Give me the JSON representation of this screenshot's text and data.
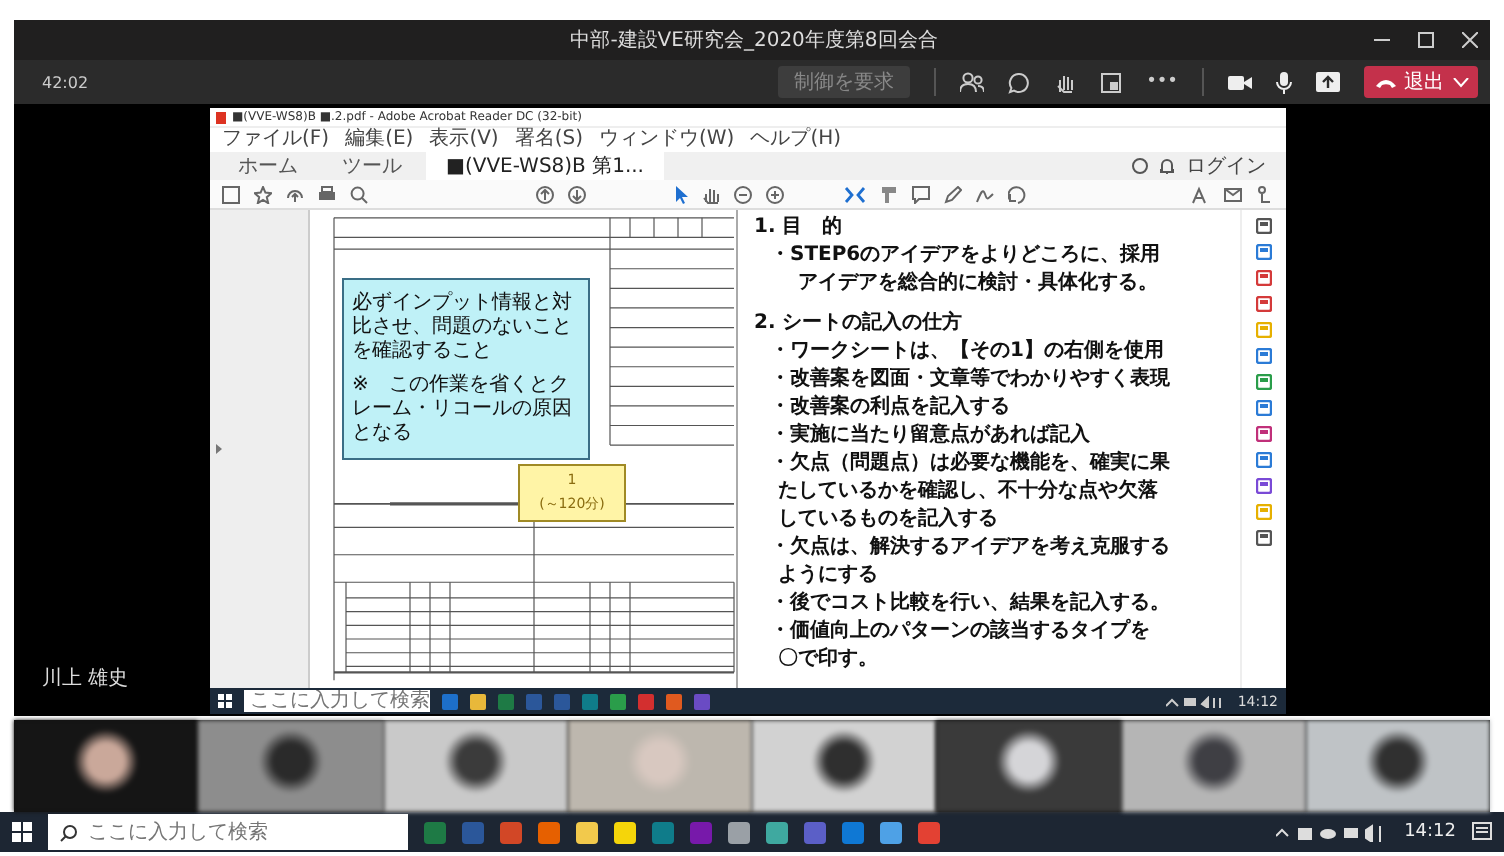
{
  "window": {
    "title": "中部-建設VE研究会_2020年度第8回会合"
  },
  "meeting_bar": {
    "timer": "42:02",
    "request_control": {
      "label": "制御を要求",
      "disabled": true
    },
    "more": "•••",
    "leave": {
      "label": "退出"
    }
  },
  "presenter": {
    "name": "川上 雄史"
  },
  "shared_screen": {
    "app_title": "■(VVE-WS8)B ■.2.pdf - Adobe Acrobat Reader DC (32-bit)",
    "menu": [
      "ファイル(F)",
      "編集(E)",
      "表示(V)",
      "署名(S)",
      "ウィンドウ(W)",
      "ヘルプ(H)"
    ],
    "tabs": [
      {
        "label": "ホーム",
        "selected": false
      },
      {
        "label": "ツール",
        "selected": false
      },
      {
        "label": "■(VVE-WS8)B 第1...",
        "selected": true
      }
    ],
    "sign_in": "ログイン",
    "worksheet": {
      "note": "必ずインプット情報と対比させ、問題のないことを確認すること",
      "warning": "※　この作業を省くとクレーム・リコールの原因となる",
      "step": "1",
      "duration": "(～120分)"
    },
    "document_lines": [
      {
        "kind": "heading",
        "text": "1. 目　的"
      },
      {
        "kind": "bullet",
        "text": "・STEP6のアイデアをよりどころに、採用"
      },
      {
        "kind": "continuation",
        "text": "アイデアを総合的に検討・具体化する。"
      },
      {
        "kind": "section",
        "text": "2. シートの記入の仕方"
      },
      {
        "kind": "bullet",
        "text": "・ワークシートは、【その1】の右側を使用"
      },
      {
        "kind": "bullet",
        "text": "・改善案を図面・文章等でわかりやすく表現"
      },
      {
        "kind": "bullet",
        "text": "・改善案の利点を記入する"
      },
      {
        "kind": "bullet",
        "text": "・実施に当たり留意点があれば記入"
      },
      {
        "kind": "bullet",
        "text": "・欠点（問題点）は必要な機能を、確実に果"
      },
      {
        "kind": "wrap",
        "text": "たしているかを確認し、不十分な点や欠落"
      },
      {
        "kind": "wrap",
        "text": "しているものを記入する"
      },
      {
        "kind": "bullet",
        "text": "・欠点は、解決するアイデアを考え克服する"
      },
      {
        "kind": "wrap",
        "text": "ようにする"
      },
      {
        "kind": "bullet",
        "text": "・後でコスト比較を行い、結果を記入する。"
      },
      {
        "kind": "bullet",
        "text": "・価値向上のパターンの該当するタイプを"
      },
      {
        "kind": "wrap",
        "text": "〇で印す。"
      }
    ],
    "taskbar": {
      "search_placeholder": "ここに入力して検索",
      "time": "14:12"
    }
  },
  "taskbar": {
    "search_placeholder": "ここに入力して検索",
    "time": "14:12"
  }
}
